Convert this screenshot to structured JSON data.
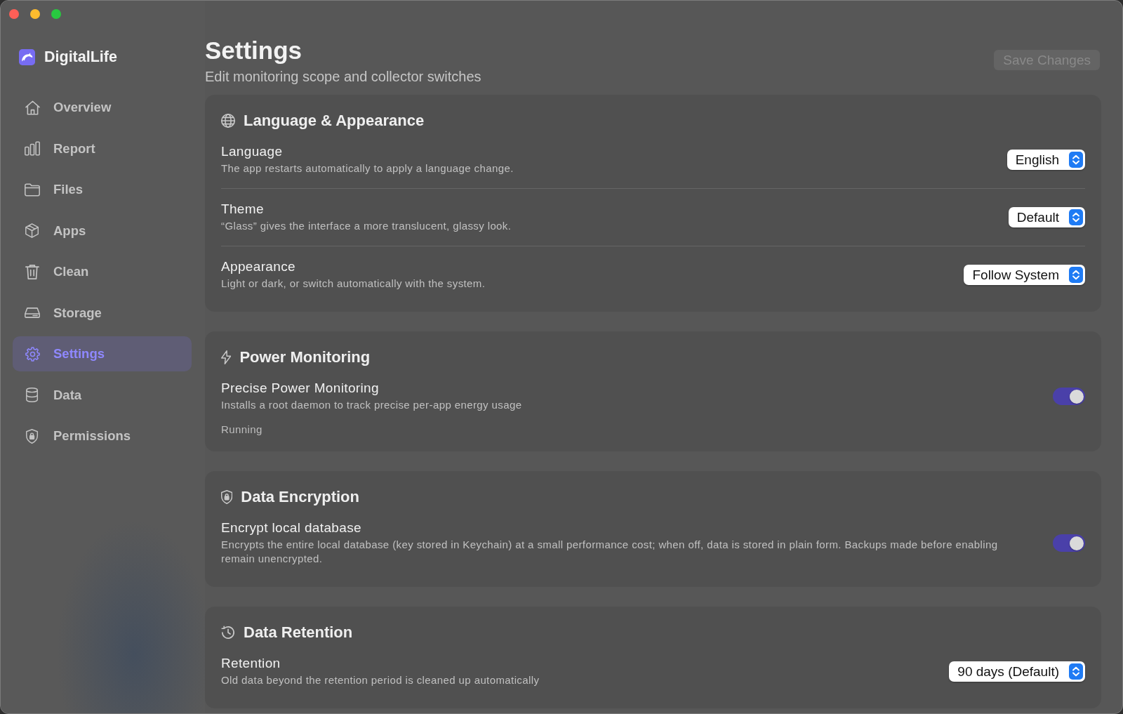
{
  "sidebar": {
    "app_name": "DigitalLife",
    "items": [
      {
        "label": "Overview",
        "selected": false
      },
      {
        "label": "Report",
        "selected": false
      },
      {
        "label": "Files",
        "selected": false
      },
      {
        "label": "Apps",
        "selected": false
      },
      {
        "label": "Clean",
        "selected": false
      },
      {
        "label": "Storage",
        "selected": false
      },
      {
        "label": "Settings",
        "selected": true
      },
      {
        "label": "Data",
        "selected": false
      },
      {
        "label": "Permissions",
        "selected": false
      }
    ]
  },
  "header": {
    "title": "Settings",
    "subtitle": "Edit monitoring scope and collector switches",
    "save_button": {
      "label": "Save Changes",
      "disabled": true
    }
  },
  "sections": [
    {
      "title": "Language & Appearance",
      "rows": [
        {
          "kind": "select",
          "label": "Language",
          "description": "The app restarts automatically to apply a language change.",
          "value": "English"
        },
        {
          "kind": "select",
          "label": "Theme",
          "description": "“Glass” gives the interface a more translucent, glassy look.",
          "value": "Default"
        },
        {
          "kind": "select",
          "label": "Appearance",
          "description": "Light or dark, or switch automatically with the system.",
          "value": "Follow System"
        }
      ]
    },
    {
      "title": "Power Monitoring",
      "rows": [
        {
          "kind": "toggle",
          "label": "Precise Power Monitoring",
          "description": "Installs a root daemon to track precise per-app energy usage",
          "status": "Running",
          "on": true
        }
      ]
    },
    {
      "title": "Data Encryption",
      "rows": [
        {
          "kind": "toggle",
          "label": "Encrypt local database",
          "description": "Encrypts the entire local database (key stored in Keychain) at a small performance cost; when off, data is stored in plain form. Backups made before enabling remain unencrypted.",
          "on": true
        }
      ]
    },
    {
      "title": "Data Retention",
      "rows": [
        {
          "kind": "select",
          "label": "Retention",
          "description": "Old data beyond the retention period is cleaned up automatically",
          "value": "90 days (Default)"
        }
      ]
    }
  ]
}
